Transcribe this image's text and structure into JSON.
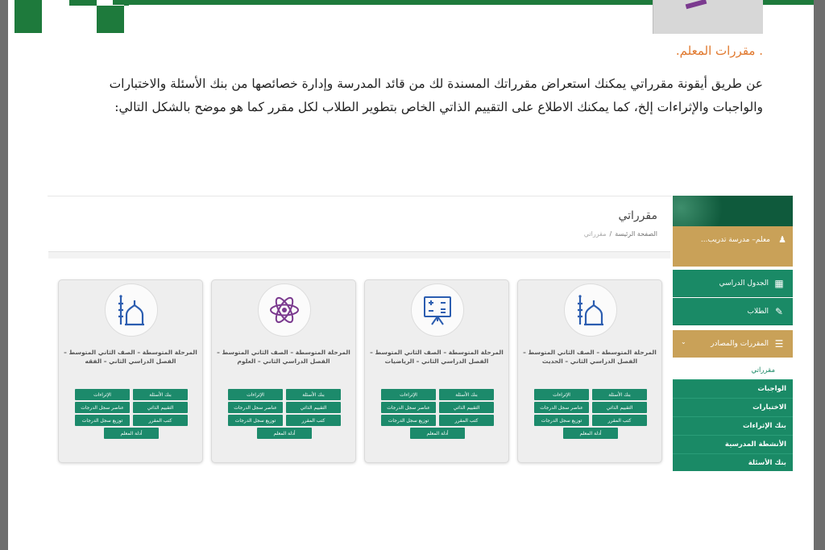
{
  "doc": {
    "heading": ". مقررات المعلم.",
    "paragraph": "عن طريق أيقونة مقرراتي يمكنك استعراض مقرراتك المسندة لك من قائد المدرسة وإدارة خصائصها من بنك الأسئلة والاختبارات والواجبات والإثراءات إلخ، كما يمكنك الاطلاع على التقييم الذاتي الخاص بتطوير الطلاب لكل مقرر كما هو موضح بالشكل التالي:"
  },
  "screenshot": {
    "page_title": "مقرراتي",
    "breadcrumb": {
      "home": "الصفحة الرئيسة",
      "sep": "/",
      "current": "مقرراتي"
    },
    "sidebar": {
      "user": "معلم– مدرسة تدريب...",
      "items": [
        {
          "label": "الجدول الدراسي",
          "icon": "calendar-icon"
        },
        {
          "label": "الطلاب",
          "icon": "student-icon"
        },
        {
          "label": "المقررات والمصادر",
          "icon": "courses-icon",
          "active": true
        }
      ],
      "subitems": [
        "مقرراتي",
        "الواجبات",
        "الاختبارات",
        "بنك الإثراءات",
        "الأنشطة المدرسية",
        "بنك الأسئلة"
      ]
    },
    "cards": [
      {
        "icon": "mosque-icon",
        "title": "المرحلة المتوسطة – الصف الثاني المتوسط – الفصل الدراسي الثاني – الحديث",
        "buttons": [
          "الإثراءات",
          "بنك الأسئلة",
          "عناصر سجل الدرجات",
          "التقييم الذاتي",
          "توزيع سجل الدرجات",
          "كتب المقرر",
          "أدلة المعلم"
        ]
      },
      {
        "icon": "math-board-icon",
        "title": "المرحلة المتوسطة – الصف الثاني المتوسط – الفصل الدراسي الثاني – الرياضيات",
        "buttons": [
          "الإثراءات",
          "بنك الأسئلة",
          "عناصر سجل الدرجات",
          "التقييم الذاتي",
          "توزيع سجل الدرجات",
          "كتب المقرر",
          "أدلة المعلم"
        ]
      },
      {
        "icon": "atom-icon",
        "title": "المرحلة المتوسطة – الصف الثاني المتوسط – الفصل الدراسي الثاني – العلوم",
        "buttons": [
          "الإثراءات",
          "بنك الأسئلة",
          "عناصر سجل الدرجات",
          "التقييم الذاتي",
          "توزيع سجل الدرجات",
          "كتب المقرر",
          "أدلة المعلم"
        ]
      },
      {
        "icon": "mosque-icon",
        "title": "المرحلة المتوسطة – الصف الثاني المتوسط – الفصل الدراسي الثاني – الفقه",
        "buttons": [
          "الإثراءات",
          "بنك الأسئلة",
          "عناصر سجل الدرجات",
          "التقييم الذاتي",
          "توزيع سجل الدرجات",
          "كتب المقرر",
          "أدلة المعلم"
        ]
      }
    ]
  }
}
